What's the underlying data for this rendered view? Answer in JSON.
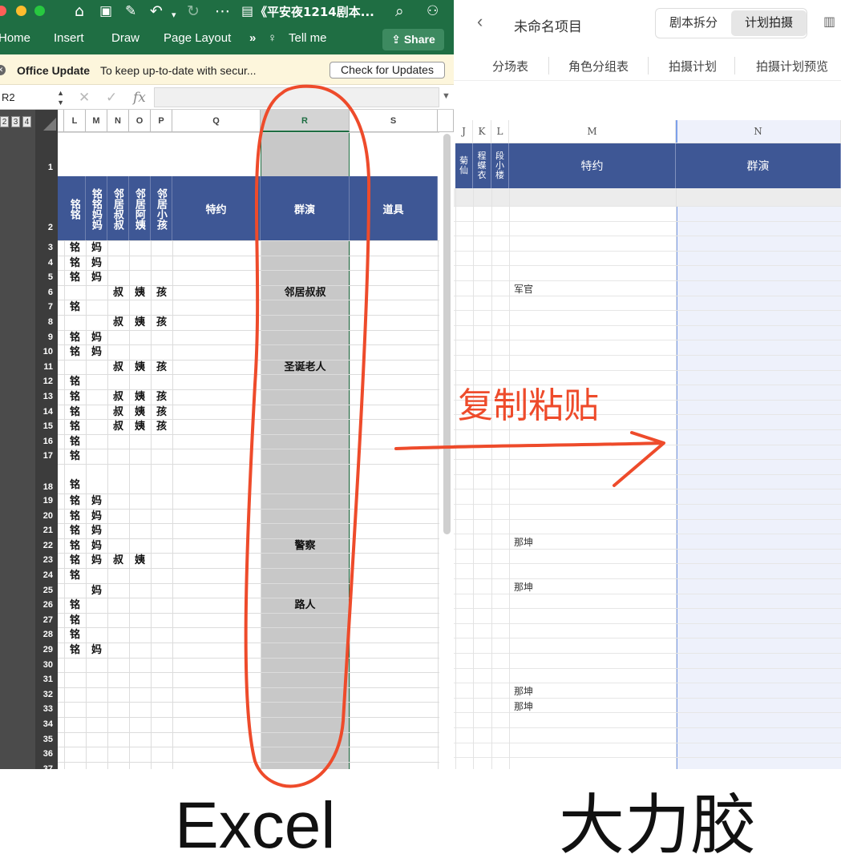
{
  "excel": {
    "window_title": "《平安夜1214剧本...",
    "ribbon_tabs": [
      "Home",
      "Insert",
      "Draw",
      "Page Layout"
    ],
    "ribbon_more": "»",
    "tell_me": "Tell me",
    "share_label": "Share",
    "update_title": "Office Update",
    "update_message": "To keep up-to-date with secur...",
    "check_updates_label": "Check for Updates",
    "name_box": "R2",
    "fx_label": "fx",
    "outline_levels": [
      "2",
      "3",
      "4"
    ],
    "columns": [
      "L",
      "M",
      "N",
      "O",
      "P",
      "Q",
      "R",
      "S"
    ],
    "header_cells": {
      "L": "铭铭",
      "M": "铭铭妈妈",
      "N": "邻居叔叔",
      "O": "邻居阿姨",
      "P": "邻居小孩",
      "Q": "特约",
      "R": "群演",
      "S": "道具"
    },
    "row_numbers": [
      "1",
      "2",
      "3",
      "4",
      "5",
      "6",
      "7",
      "8",
      "9",
      "10",
      "11",
      "12",
      "13",
      "14",
      "15",
      "16",
      "17",
      "18",
      "19",
      "20",
      "21",
      "22",
      "23",
      "24",
      "25",
      "26",
      "27",
      "28",
      "29",
      "30",
      "31",
      "32",
      "33",
      "34",
      "35",
      "36",
      "37"
    ],
    "rows": [
      {
        "r": 3,
        "L": "铭",
        "M": "妈"
      },
      {
        "r": 4,
        "L": "铭",
        "M": "妈"
      },
      {
        "r": 5,
        "L": "铭",
        "M": "妈"
      },
      {
        "r": 6,
        "N": "叔",
        "O": "姨",
        "P": "孩",
        "R": "邻居叔叔"
      },
      {
        "r": 7,
        "L": "铭"
      },
      {
        "r": 8,
        "N": "叔",
        "O": "姨",
        "P": "孩"
      },
      {
        "r": 9,
        "L": "铭",
        "M": "妈"
      },
      {
        "r": 10,
        "L": "铭",
        "M": "妈"
      },
      {
        "r": 11,
        "N": "叔",
        "O": "姨",
        "P": "孩",
        "R": "圣诞老人"
      },
      {
        "r": 12,
        "L": "铭"
      },
      {
        "r": 13,
        "L": "铭",
        "N": "叔",
        "O": "姨",
        "P": "孩"
      },
      {
        "r": 14,
        "L": "铭",
        "N": "叔",
        "O": "姨",
        "P": "孩"
      },
      {
        "r": 15,
        "L": "铭",
        "N": "叔",
        "O": "姨",
        "P": "孩"
      },
      {
        "r": 16,
        "L": "铭"
      },
      {
        "r": 17,
        "L": "铭"
      },
      {
        "r": 18,
        "L": "铭"
      },
      {
        "r": 19,
        "L": "铭",
        "M": "妈"
      },
      {
        "r": 20,
        "L": "铭",
        "M": "妈"
      },
      {
        "r": 21,
        "L": "铭",
        "M": "妈"
      },
      {
        "r": 22,
        "L": "铭",
        "M": "妈",
        "R": "警察"
      },
      {
        "r": 23,
        "L": "铭",
        "M": "妈",
        "N": "叔",
        "O": "姨"
      },
      {
        "r": 24,
        "L": "铭"
      },
      {
        "r": 25,
        "M": "妈"
      },
      {
        "r": 26,
        "L": "铭",
        "R": "路人"
      },
      {
        "r": 27,
        "L": "铭"
      },
      {
        "r": 28,
        "L": "铭"
      },
      {
        "r": 29,
        "L": "铭",
        "M": "妈"
      }
    ]
  },
  "dalijiao": {
    "project_title": "未命名项目",
    "seg_left": "剧本拆分",
    "seg_right": "计划拍摄",
    "tabs": [
      "分场表",
      "角色分组表",
      "拍摄计划",
      "拍摄计划预览"
    ],
    "columns": [
      "J",
      "K",
      "L",
      "M",
      "N"
    ],
    "header_cells": {
      "J": "菊仙",
      "K": "程蝶衣",
      "L": "段小楼",
      "M": "特约",
      "N": "群演"
    },
    "m_cells": [
      {
        "row": 8,
        "text": "军官"
      },
      {
        "row": 25,
        "text": "那坤"
      },
      {
        "row": 28,
        "text": "那坤"
      },
      {
        "row": 35,
        "text": "那坤"
      },
      {
        "row": 36,
        "text": "那坤"
      }
    ]
  },
  "annotation": {
    "arrow_text": "复制粘贴",
    "left_label": "Excel",
    "right_label": "大力胶",
    "color": "#ee4b2b"
  },
  "colors": {
    "excel_green": "#1f6e43",
    "header_blue": "#3e5795",
    "update_bar": "#fdf6dc",
    "selection_gray": "#c8c8c8",
    "dlj_selected_col": "#eef1fb"
  }
}
